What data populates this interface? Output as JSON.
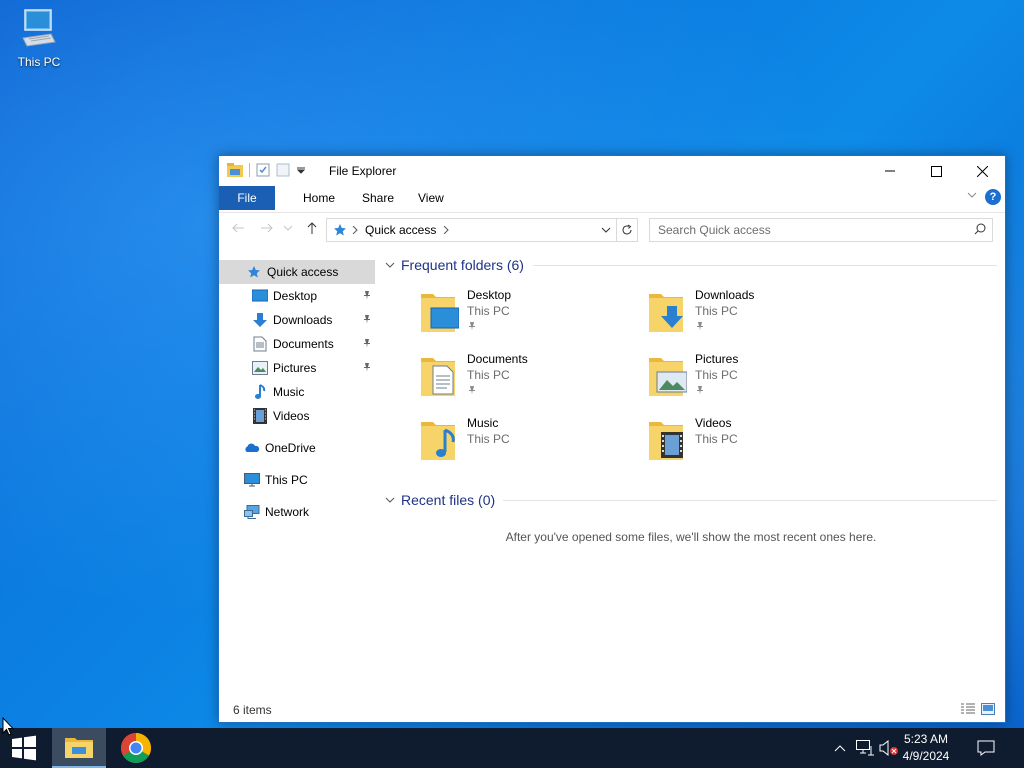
{
  "desktop": {
    "icons": [
      {
        "label": "This PC",
        "icon": "this-pc-icon"
      }
    ]
  },
  "window": {
    "title": "File Explorer",
    "ribbon_tabs": [
      "File",
      "Home",
      "Share",
      "View"
    ],
    "help_label": "?",
    "address": {
      "path": "Quick access"
    },
    "search": {
      "placeholder": "Search Quick access"
    },
    "status": {
      "item_count": "6 items"
    }
  },
  "sidebar": {
    "items": [
      {
        "label": "Quick access",
        "icon": "quick-access-star-icon",
        "selected": true,
        "pinned": false
      },
      {
        "label": "Desktop",
        "icon": "desktop-folder-icon",
        "pinned": true
      },
      {
        "label": "Downloads",
        "icon": "downloads-arrow-icon",
        "pinned": true
      },
      {
        "label": "Documents",
        "icon": "documents-icon",
        "pinned": true
      },
      {
        "label": "Pictures",
        "icon": "pictures-icon",
        "pinned": true
      },
      {
        "label": "Music",
        "icon": "music-note-icon",
        "pinned": false
      },
      {
        "label": "Videos",
        "icon": "videos-icon",
        "pinned": false
      },
      {
        "label": "OneDrive",
        "icon": "onedrive-cloud-icon",
        "pinned": false
      },
      {
        "label": "This PC",
        "icon": "this-pc-icon",
        "pinned": false
      },
      {
        "label": "Network",
        "icon": "network-icon",
        "pinned": false
      }
    ]
  },
  "content": {
    "frequent_header": "Frequent folders (6)",
    "folders": [
      {
        "name": "Desktop",
        "location": "This PC",
        "pinned": true,
        "overlay": "desktop-overlay-icon"
      },
      {
        "name": "Downloads",
        "location": "This PC",
        "pinned": true,
        "overlay": "download-arrow-overlay-icon"
      },
      {
        "name": "Documents",
        "location": "This PC",
        "pinned": true,
        "overlay": "document-overlay-icon"
      },
      {
        "name": "Pictures",
        "location": "This PC",
        "pinned": true,
        "overlay": "picture-overlay-icon"
      },
      {
        "name": "Music",
        "location": "This PC",
        "pinned": false,
        "overlay": "music-note-overlay-icon"
      },
      {
        "name": "Videos",
        "location": "This PC",
        "pinned": false,
        "overlay": "film-overlay-icon"
      }
    ],
    "recent_header": "Recent files (0)",
    "recent_empty_message": "After you've opened some files, we'll show the most recent ones here."
  },
  "taskbar": {
    "clock_time": "5:23 AM",
    "clock_date": "4/9/2024",
    "apps": [
      "start-windows-icon",
      "file-explorer-icon",
      "chrome-icon"
    ],
    "tray": [
      "show-hidden-icons-chevron",
      "network-icon",
      "volume-muted-icon",
      "notifications-icon"
    ]
  },
  "colors": {
    "accent": "#1a5fb4",
    "header_blue": "#1e3287",
    "taskbar": "#0f1b2e",
    "folder_yellow": "#f3c94f"
  }
}
